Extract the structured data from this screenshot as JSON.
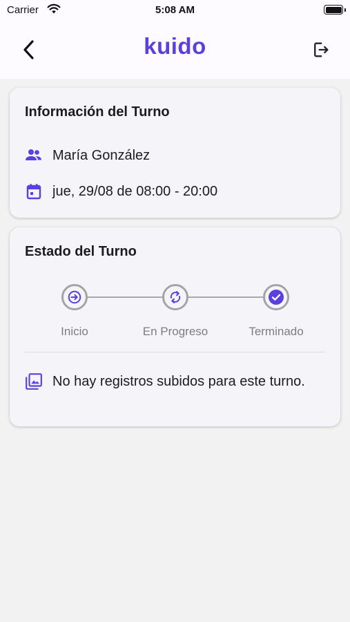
{
  "status_bar": {
    "carrier": "Carrier",
    "time": "5:08 AM",
    "battery_level": 1.0
  },
  "app_bar": {
    "brand": "kuido",
    "back_icon": "chevron-left-icon",
    "logout_icon": "logout-icon"
  },
  "shift_info": {
    "title": "Información del Turno",
    "person_icon": "people-icon",
    "person": "María González",
    "date_icon": "calendar-icon",
    "schedule": "jue, 29/08 de 08:00 - 20:00"
  },
  "shift_status": {
    "title": "Estado del Turno",
    "steps": [
      {
        "label": "Inicio",
        "icon": "login-icon"
      },
      {
        "label": "En Progreso",
        "icon": "sync-icon"
      },
      {
        "label": "Terminado",
        "icon": "check-circle-icon"
      }
    ],
    "records_icon": "photo-library-icon",
    "records_message": "No hay registros subidos para este turno."
  },
  "colors": {
    "accent": "#5b3fe0",
    "card_bg": "#f5f4f8",
    "page_bg": "#f2f2f3",
    "step_border": "#a3a3a8",
    "step_label": "#7c7c82"
  }
}
